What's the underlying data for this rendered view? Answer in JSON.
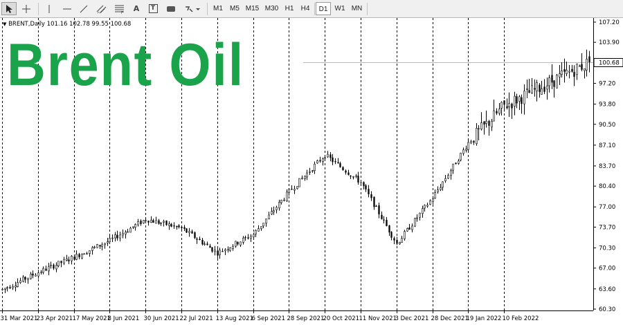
{
  "toolbar": {
    "tools": [
      {
        "name": "cursor-icon"
      },
      {
        "name": "crosshair-icon"
      },
      {
        "name": "vertical-line-icon"
      },
      {
        "name": "horizontal-line-icon"
      },
      {
        "name": "trend-line-icon"
      },
      {
        "name": "equidistant-channel-icon"
      },
      {
        "name": "fibonacci-icon"
      },
      {
        "name": "text-icon",
        "label": "A"
      },
      {
        "name": "text-label-icon",
        "label": "T"
      },
      {
        "name": "rectangle-icon"
      },
      {
        "name": "shapes-dropdown-icon"
      }
    ],
    "timeframes": [
      "M1",
      "M5",
      "M15",
      "M30",
      "H1",
      "H4",
      "D1",
      "W1",
      "MN"
    ],
    "active_timeframe": "D1"
  },
  "symbol_info": "BRENT,Daily  101.16 102.78 99.55 100.68",
  "watermark_text": "Brent Oil",
  "colors": {
    "watermark": "#1aa34a",
    "candle": "#000000",
    "grid": "#000000",
    "price_line": "#b8b8b8",
    "background": "#ffffff"
  },
  "chart_data": {
    "type": "candlestick",
    "symbol": "BRENT",
    "timeframe": "Daily",
    "last_ohlc": {
      "open": 101.16,
      "high": 102.78,
      "low": 99.55,
      "close": 100.68
    },
    "current_price_label": "100.68",
    "y_axis": {
      "ylim": [
        60.3,
        107.2
      ],
      "ticks": [
        "107.20",
        "103.90",
        "100.68",
        "97.20",
        "93.80",
        "90.50",
        "87.10",
        "83.70",
        "80.40",
        "77.00",
        "73.70",
        "70.30",
        "67.00",
        "63.60",
        "60.30"
      ]
    },
    "x_axis": {
      "ticks": [
        "31 Mar 2021",
        "23 Apr 2021",
        "17 May 2021",
        "8 Jun 2021",
        "30 Jun 2021",
        "22 Jul 2021",
        "13 Aug 2021",
        "6 Sep 2021",
        "28 Sep 2021",
        "20 Oct 2021",
        "11 Nov 2021",
        "3 Dec 2021",
        "28 Dec 2021",
        "19 Jan 2022",
        "10 Feb 2022"
      ]
    },
    "grid": "vertical-dashed",
    "approximate_close_path": [
      [
        "31 Mar 2021",
        63.5
      ],
      [
        "23 Apr 2021",
        66.3
      ],
      [
        "17 May 2021",
        68.8
      ],
      [
        "8 Jun 2021",
        71.5
      ],
      [
        "30 Jun 2021",
        75.0
      ],
      [
        "22 Jul 2021",
        73.5
      ],
      [
        "13 Aug 2021",
        69.5
      ],
      [
        "6 Sep 2021",
        72.5
      ],
      [
        "28 Sep 2021",
        79.5
      ],
      [
        "20 Oct 2021",
        85.5
      ],
      [
        "11 Nov 2021",
        81.0
      ],
      [
        "3 Dec 2021",
        71.0
      ],
      [
        "28 Dec 2021",
        78.5
      ],
      [
        "19 Jan 2022",
        87.5
      ],
      [
        "10 Feb 2022",
        93.5
      ],
      [
        "24 Feb 2022",
        100.68
      ]
    ]
  }
}
